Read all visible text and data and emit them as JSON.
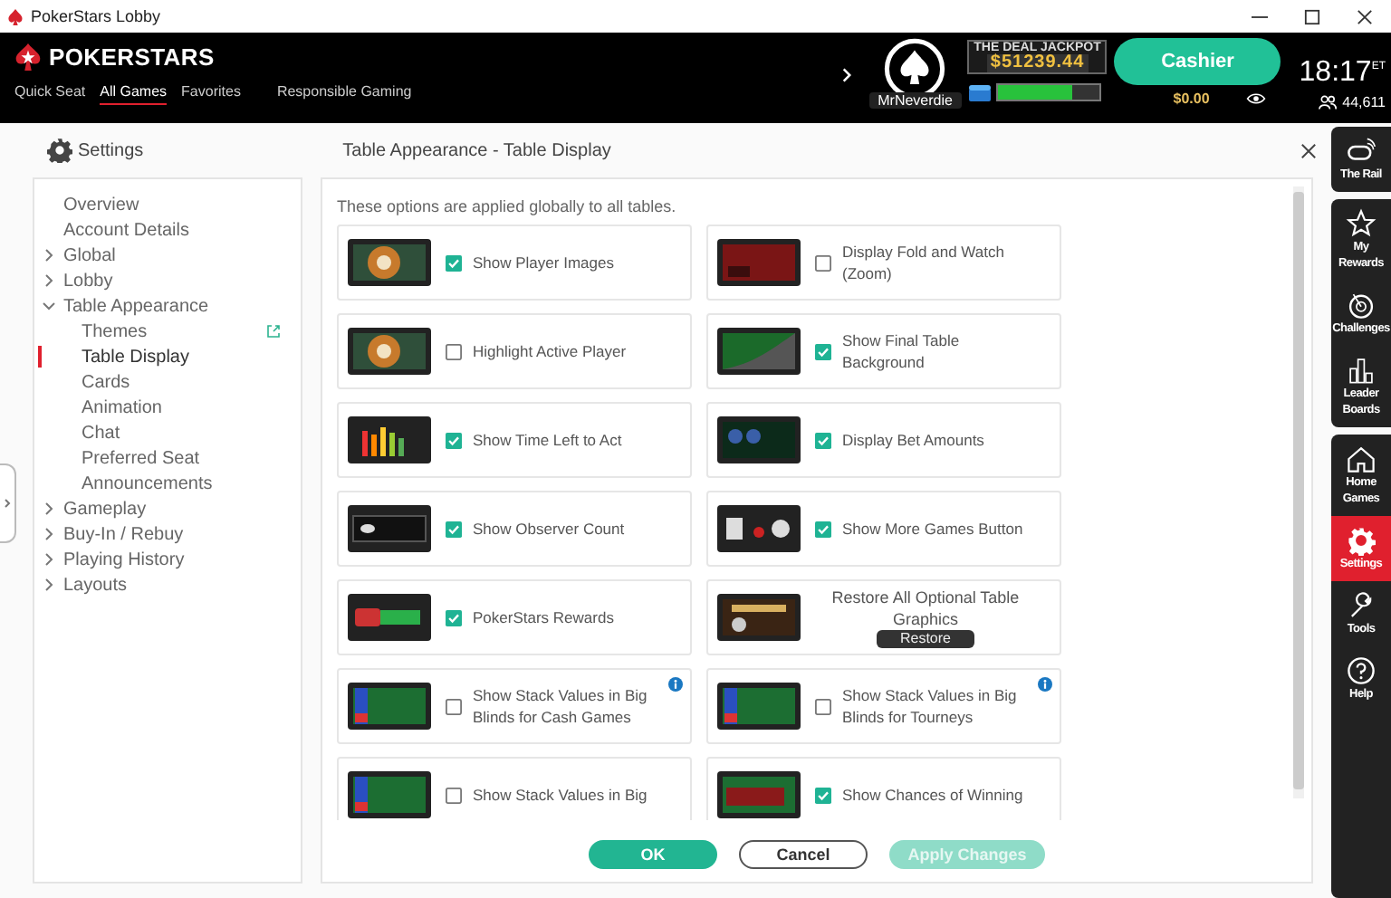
{
  "window": {
    "title": "PokerStars Lobby"
  },
  "header": {
    "logo": "POKERSTARS",
    "nav": [
      {
        "label": "Quick Seat",
        "selected": false
      },
      {
        "label": "All Games",
        "selected": true
      },
      {
        "label": "Favorites",
        "selected": false
      },
      {
        "label": "Responsible Gaming",
        "selected": false
      }
    ],
    "username": "MrNeverdie",
    "jackpot": {
      "title": "THE DEAL JACKPOT",
      "amount": "$51239.44"
    },
    "rewards_bar": {
      "level": 0.72
    },
    "cashier": "Cashier",
    "balance": "$0.00",
    "clock": {
      "time": "18:17",
      "zone": "ET"
    },
    "players_online": "44,611"
  },
  "settings": {
    "title": "Settings",
    "page_title": "Table Appearance - Table Display",
    "nav": [
      {
        "label": "Overview",
        "selected": false
      },
      {
        "label": "Account Details",
        "selected": false
      },
      {
        "label": "Global",
        "selected": false,
        "expanded": false
      },
      {
        "label": "Lobby",
        "selected": false,
        "expanded": false
      },
      {
        "label": "Table Appearance",
        "selected": false,
        "expanded": true,
        "children": [
          {
            "label": "Themes",
            "selected": false,
            "external": true
          },
          {
            "label": "Table Display",
            "selected": true,
            "external": false
          },
          {
            "label": "Cards",
            "selected": false,
            "external": false
          },
          {
            "label": "Animation",
            "selected": false,
            "external": false
          },
          {
            "label": "Chat",
            "selected": false,
            "external": false
          },
          {
            "label": "Preferred Seat",
            "selected": false,
            "external": false
          },
          {
            "label": "Announcements",
            "selected": false,
            "external": false
          }
        ]
      },
      {
        "label": "Gameplay",
        "selected": false,
        "expanded": false
      },
      {
        "label": "Buy-In / Rebuy",
        "selected": false,
        "expanded": false
      },
      {
        "label": "Playing History",
        "selected": false,
        "expanded": false
      },
      {
        "label": "Layouts",
        "selected": false,
        "expanded": false
      }
    ],
    "intro": "These options are applied globally to all tables.",
    "options": [
      {
        "kind": "checkbox",
        "label": "Show Player Images",
        "checked": true,
        "info": false
      },
      {
        "kind": "checkbox",
        "label": "Display Fold and Watch (Zoom)",
        "checked": false,
        "info": false
      },
      {
        "kind": "checkbox",
        "label": "Highlight Active Player",
        "checked": false,
        "info": false
      },
      {
        "kind": "checkbox",
        "label": "Show Final Table Background",
        "checked": true,
        "info": false
      },
      {
        "kind": "checkbox",
        "label": "Show Time Left to Act",
        "checked": true,
        "info": false
      },
      {
        "kind": "checkbox",
        "label": "Display Bet Amounts",
        "checked": true,
        "info": false
      },
      {
        "kind": "checkbox",
        "label": "Show Observer Count",
        "checked": true,
        "info": false
      },
      {
        "kind": "checkbox",
        "label": "Show More Games Button",
        "checked": true,
        "info": false
      },
      {
        "kind": "checkbox",
        "label": "PokerStars Rewards",
        "checked": true,
        "info": false
      },
      {
        "kind": "restore",
        "label": "Restore All Optional Table Graphics",
        "button": "Restore"
      },
      {
        "kind": "checkbox",
        "label": "Show Stack Values in Big Blinds for Cash Games",
        "checked": false,
        "info": true
      },
      {
        "kind": "checkbox",
        "label": "Show Stack Values in Big Blinds for Tourneys",
        "checked": false,
        "info": true
      },
      {
        "kind": "checkbox",
        "label": "Show Stack Values in Big",
        "checked": false,
        "info": false
      },
      {
        "kind": "checkbox",
        "label": "Show Chances of Winning",
        "checked": true,
        "info": false
      }
    ],
    "buttons": [
      {
        "label": "OK",
        "kind": "primary",
        "disabled": false
      },
      {
        "label": "Cancel",
        "kind": "secondary",
        "disabled": false
      },
      {
        "label": "Apply Changes",
        "kind": "primary",
        "disabled": true
      }
    ]
  },
  "sidebar": {
    "groups": [
      [
        {
          "label": "The Rail",
          "selected": false
        }
      ],
      [
        {
          "label": "My Rewards",
          "selected": false
        },
        {
          "label": "Challenges",
          "selected": false
        },
        {
          "label": "Leader Boards",
          "selected": false
        }
      ],
      [
        {
          "label": "Home Games",
          "selected": false
        },
        {
          "label": "Settings",
          "selected": true
        },
        {
          "label": "Tools",
          "selected": false
        },
        {
          "label": "Help",
          "selected": false
        }
      ]
    ]
  }
}
